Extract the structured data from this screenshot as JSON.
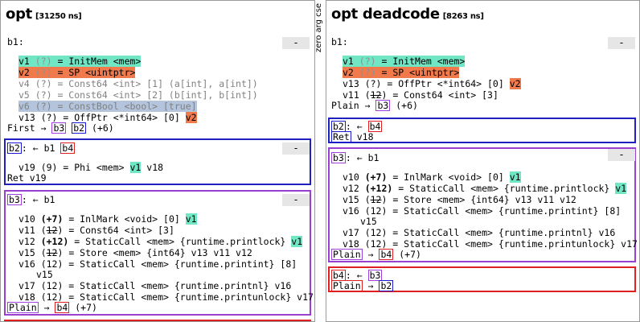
{
  "sidebar": {
    "label": "zero arg cse"
  },
  "left": {
    "title": "opt",
    "time": "[31250 ns]",
    "collapse": "-",
    "b1": {
      "header": "b1:",
      "v1": {
        "name": "v1",
        "uses": "(?)",
        "rest": "= InitMem <mem>"
      },
      "v2": {
        "name": "v2",
        "uses": "(?)",
        "rest": "= SP <uintptr>"
      },
      "v4": "v4 (?) = Const64 <int> [1] (a[int], a[int])",
      "v5": "v5 (?) = Const64 <int> [2] (b[int], b[int])",
      "v6": "v6 (?) = ConstBool <bool> [true]",
      "v13": {
        "text": "v13 (?) = OffPtr <*int64> [0]",
        "arg": "v2"
      },
      "term": {
        "kind": "First",
        "arrow": "→",
        "s1": "b3",
        "s2": "b2",
        "likely": "(+6)"
      }
    },
    "b2": {
      "label": "b2",
      "colon": ":",
      "pred_arrow": "←",
      "pred1": "b1",
      "pred2": "b4",
      "v19": {
        "text": "v19 (9) = Phi <mem>",
        "arg1": "v1",
        "arg2": "v18"
      },
      "term": {
        "kind": "Ret",
        "arg": "v19"
      }
    },
    "b3": {
      "label": "b3",
      "colon": ":",
      "pred_arrow": "←",
      "pred1": "b1",
      "v10": {
        "pre": "v10 ",
        "uses": "(+7)",
        "post": " = InlMark <void> [0]",
        "arg": "v1"
      },
      "v11": {
        "pre": "v11 (",
        "strike": "12",
        "post": ") = Const64 <int> [3]"
      },
      "v12": {
        "pre": "v12 ",
        "uses": "(+12)",
        "post": " = StaticCall <mem> {runtime.printlock}",
        "arg": "v1"
      },
      "v15": {
        "pre": "v15 (",
        "strike": "12",
        "post": ") = Store <mem> {int64} v13 v11 v12"
      },
      "v16": {
        "text": "v16 (12) = StaticCall <mem> {runtime.printint} [8]",
        "cont": "v15"
      },
      "v17": "v17 (12) = StaticCall <mem> {runtime.printnl} v16",
      "v18": "v18 (12) = StaticCall <mem> {runtime.printunlock} v17",
      "term": {
        "kind": "Plain",
        "arrow": "→",
        "s1": "b4",
        "likely": "(+7)"
      }
    }
  },
  "right": {
    "title": "opt deadcode",
    "time": "[8263 ns]",
    "collapse": "-",
    "b1": {
      "header": "b1:",
      "v1": {
        "name": "v1",
        "uses": "(?)",
        "rest": "= InitMem <mem>"
      },
      "v2": {
        "name": "v2",
        "uses": "(?)",
        "rest": "= SP <uintptr>"
      },
      "v13": {
        "text": "v13 (?) = OffPtr <*int64> [0]",
        "arg": "v2"
      },
      "v11": {
        "pre": "v11 (",
        "strike": "12",
        "post": ") = Const64 <int> [3]"
      },
      "term": {
        "kind": "Plain",
        "arrow": "→",
        "s1": "b3",
        "likely": "(+6)"
      }
    },
    "b2": {
      "label": "b2",
      "colon": ":",
      "pred_arrow": "←",
      "pred1": "b4",
      "term": {
        "kind": "Ret",
        "arg": "v18"
      }
    },
    "b3": {
      "label": "b3",
      "colon": ":",
      "pred_arrow": "←",
      "pred1": "b1",
      "v10": {
        "pre": "v10 ",
        "uses": "(+7)",
        "post": " = InlMark <void> [0]",
        "arg": "v1"
      },
      "v12": {
        "pre": "v12 ",
        "uses": "(+12)",
        "post": " = StaticCall <mem> {runtime.printlock}",
        "arg": "v1"
      },
      "v15": {
        "pre": "v15 (",
        "strike": "12",
        "post": ") = Store <mem> {int64} v13 v11 v12"
      },
      "v16": {
        "text": "v16 (12) = StaticCall <mem> {runtime.printint} [8]",
        "cont": "v15"
      },
      "v17": "v17 (12) = StaticCall <mem> {runtime.printnl} v16",
      "v18": "v18 (12) = StaticCall <mem> {runtime.printunlock} v17",
      "term": {
        "kind": "Plain",
        "arrow": "→",
        "s1": "b4",
        "likely": "(+7)"
      }
    },
    "b4": {
      "label": "b4",
      "colon": ":",
      "pred_arrow": "←",
      "pred1": "b3",
      "term": {
        "kind": "Plain",
        "arrow": "→",
        "s1": "b2"
      }
    }
  },
  "colors": {
    "block_blue": "#2020c0",
    "block_purple": "#9a40d0",
    "block_red": "#e02020",
    "value_green": "#70e6c4",
    "value_orange": "#f07a4c",
    "value_dead": "#b4c4dc"
  }
}
